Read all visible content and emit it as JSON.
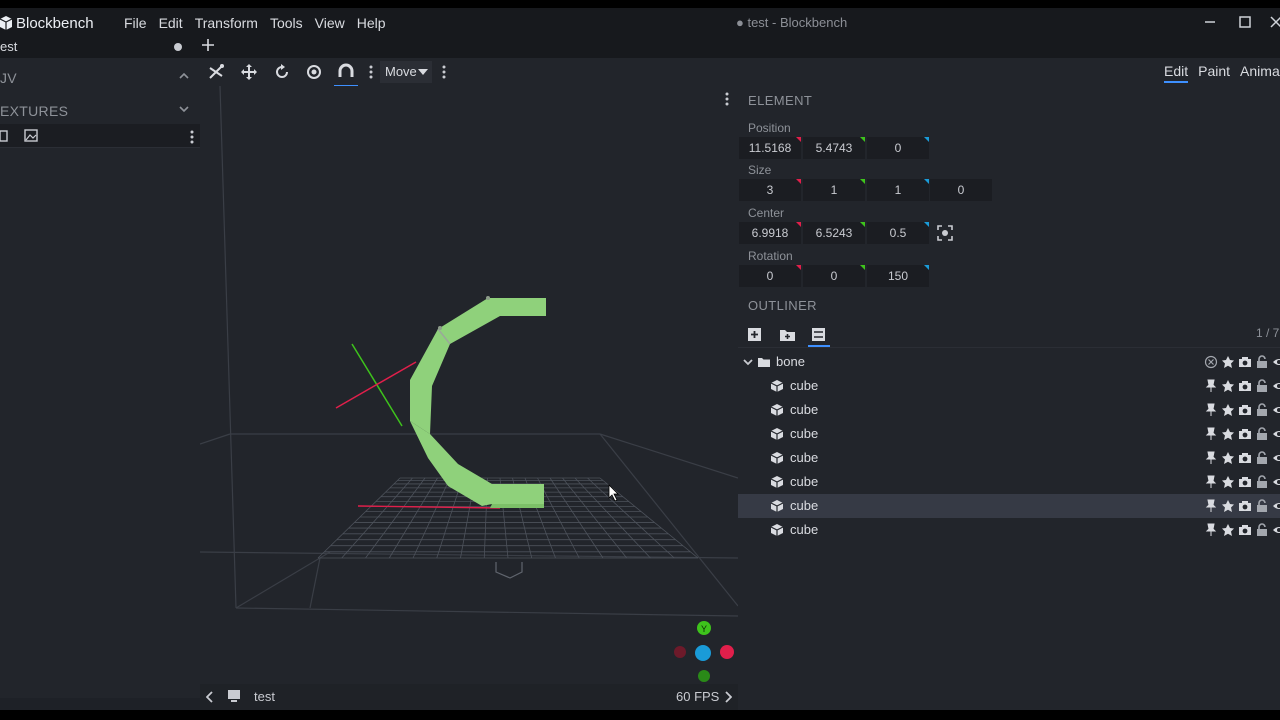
{
  "app": {
    "brand": "Blockbench",
    "window_title": "● test - Blockbench",
    "menu": [
      "File",
      "Edit",
      "Transform",
      "Tools",
      "View",
      "Help"
    ]
  },
  "tabs": {
    "project_tab": "est"
  },
  "left_panel": {
    "uv_header": "JV",
    "textures_header": "EXTURES"
  },
  "toolbar": {
    "tool_mode": "Move"
  },
  "mode_tabs": [
    "Edit",
    "Paint",
    "Animate"
  ],
  "element_panel": {
    "title": "ELEMENT",
    "position": {
      "label": "Position",
      "values": [
        "11.5168",
        "5.4743",
        "0"
      ]
    },
    "size": {
      "label": "Size",
      "values": [
        "3",
        "1",
        "1",
        "0"
      ]
    },
    "center": {
      "label": "Center",
      "values": [
        "6.9918",
        "6.5243",
        "0.5"
      ]
    },
    "rotation": {
      "label": "Rotation",
      "values": [
        "0",
        "0",
        "150"
      ]
    }
  },
  "outliner": {
    "title": "OUTLINER",
    "count": "1 / 7",
    "group": "bone",
    "items": [
      "cube",
      "cube",
      "cube",
      "cube",
      "cube",
      "cube",
      "cube"
    ],
    "selected_index": 5
  },
  "viewport_status": {
    "project_name": "test",
    "fps": "60 FPS"
  },
  "gizmo": {
    "y_label": "Y"
  },
  "colors": {
    "accent": "#3e90ff",
    "x_axis": "#e11f4b",
    "y_axis": "#3ec31c",
    "z_axis": "#1a9bd8",
    "model": "#8fd17b"
  }
}
